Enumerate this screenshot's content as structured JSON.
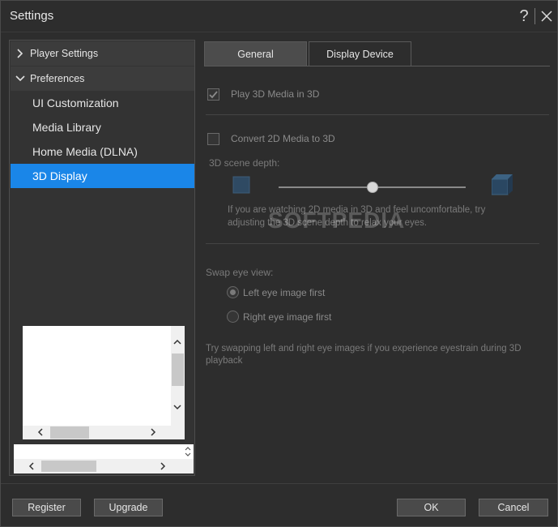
{
  "window": {
    "title": "Settings",
    "help_label": "?"
  },
  "tree": {
    "groups": [
      {
        "label": "Player Settings"
      },
      {
        "label": "Preferences"
      }
    ],
    "items": [
      {
        "label": "UI Customization"
      },
      {
        "label": "Media Library"
      },
      {
        "label": "Home Media (DLNA)"
      },
      {
        "label": "3D Display"
      }
    ]
  },
  "tabs": [
    {
      "label": "General"
    },
    {
      "label": "Display Device"
    }
  ],
  "options": {
    "play3d_label": "Play 3D Media in 3D",
    "convert2d_label": "Convert 2D Media to 3D",
    "scene_depth_label": "3D scene depth:",
    "scene_depth_value": 0.5,
    "depth_hint_line1": "If you are watching 2D media in 3D and feel uncomfortable, try",
    "depth_hint_line2": "adjusting the 3D scene depth to relax your eyes.",
    "swap_eye_label": "Swap eye view:",
    "left_eye_label": "Left eye image first",
    "right_eye_label": "Right eye image first",
    "swap_hint_line1": "Try swapping left and right eye images if you experience eyestrain during 3D",
    "swap_hint_line2": "playback"
  },
  "watermark": "SOFTPEDIA",
  "footer": {
    "register_label": "Register",
    "upgrade_label": "Upgrade",
    "ok_label": "OK",
    "cancel_label": "Cancel"
  },
  "colors": {
    "accent": "#1a86e8",
    "background": "#2d2d2d"
  }
}
